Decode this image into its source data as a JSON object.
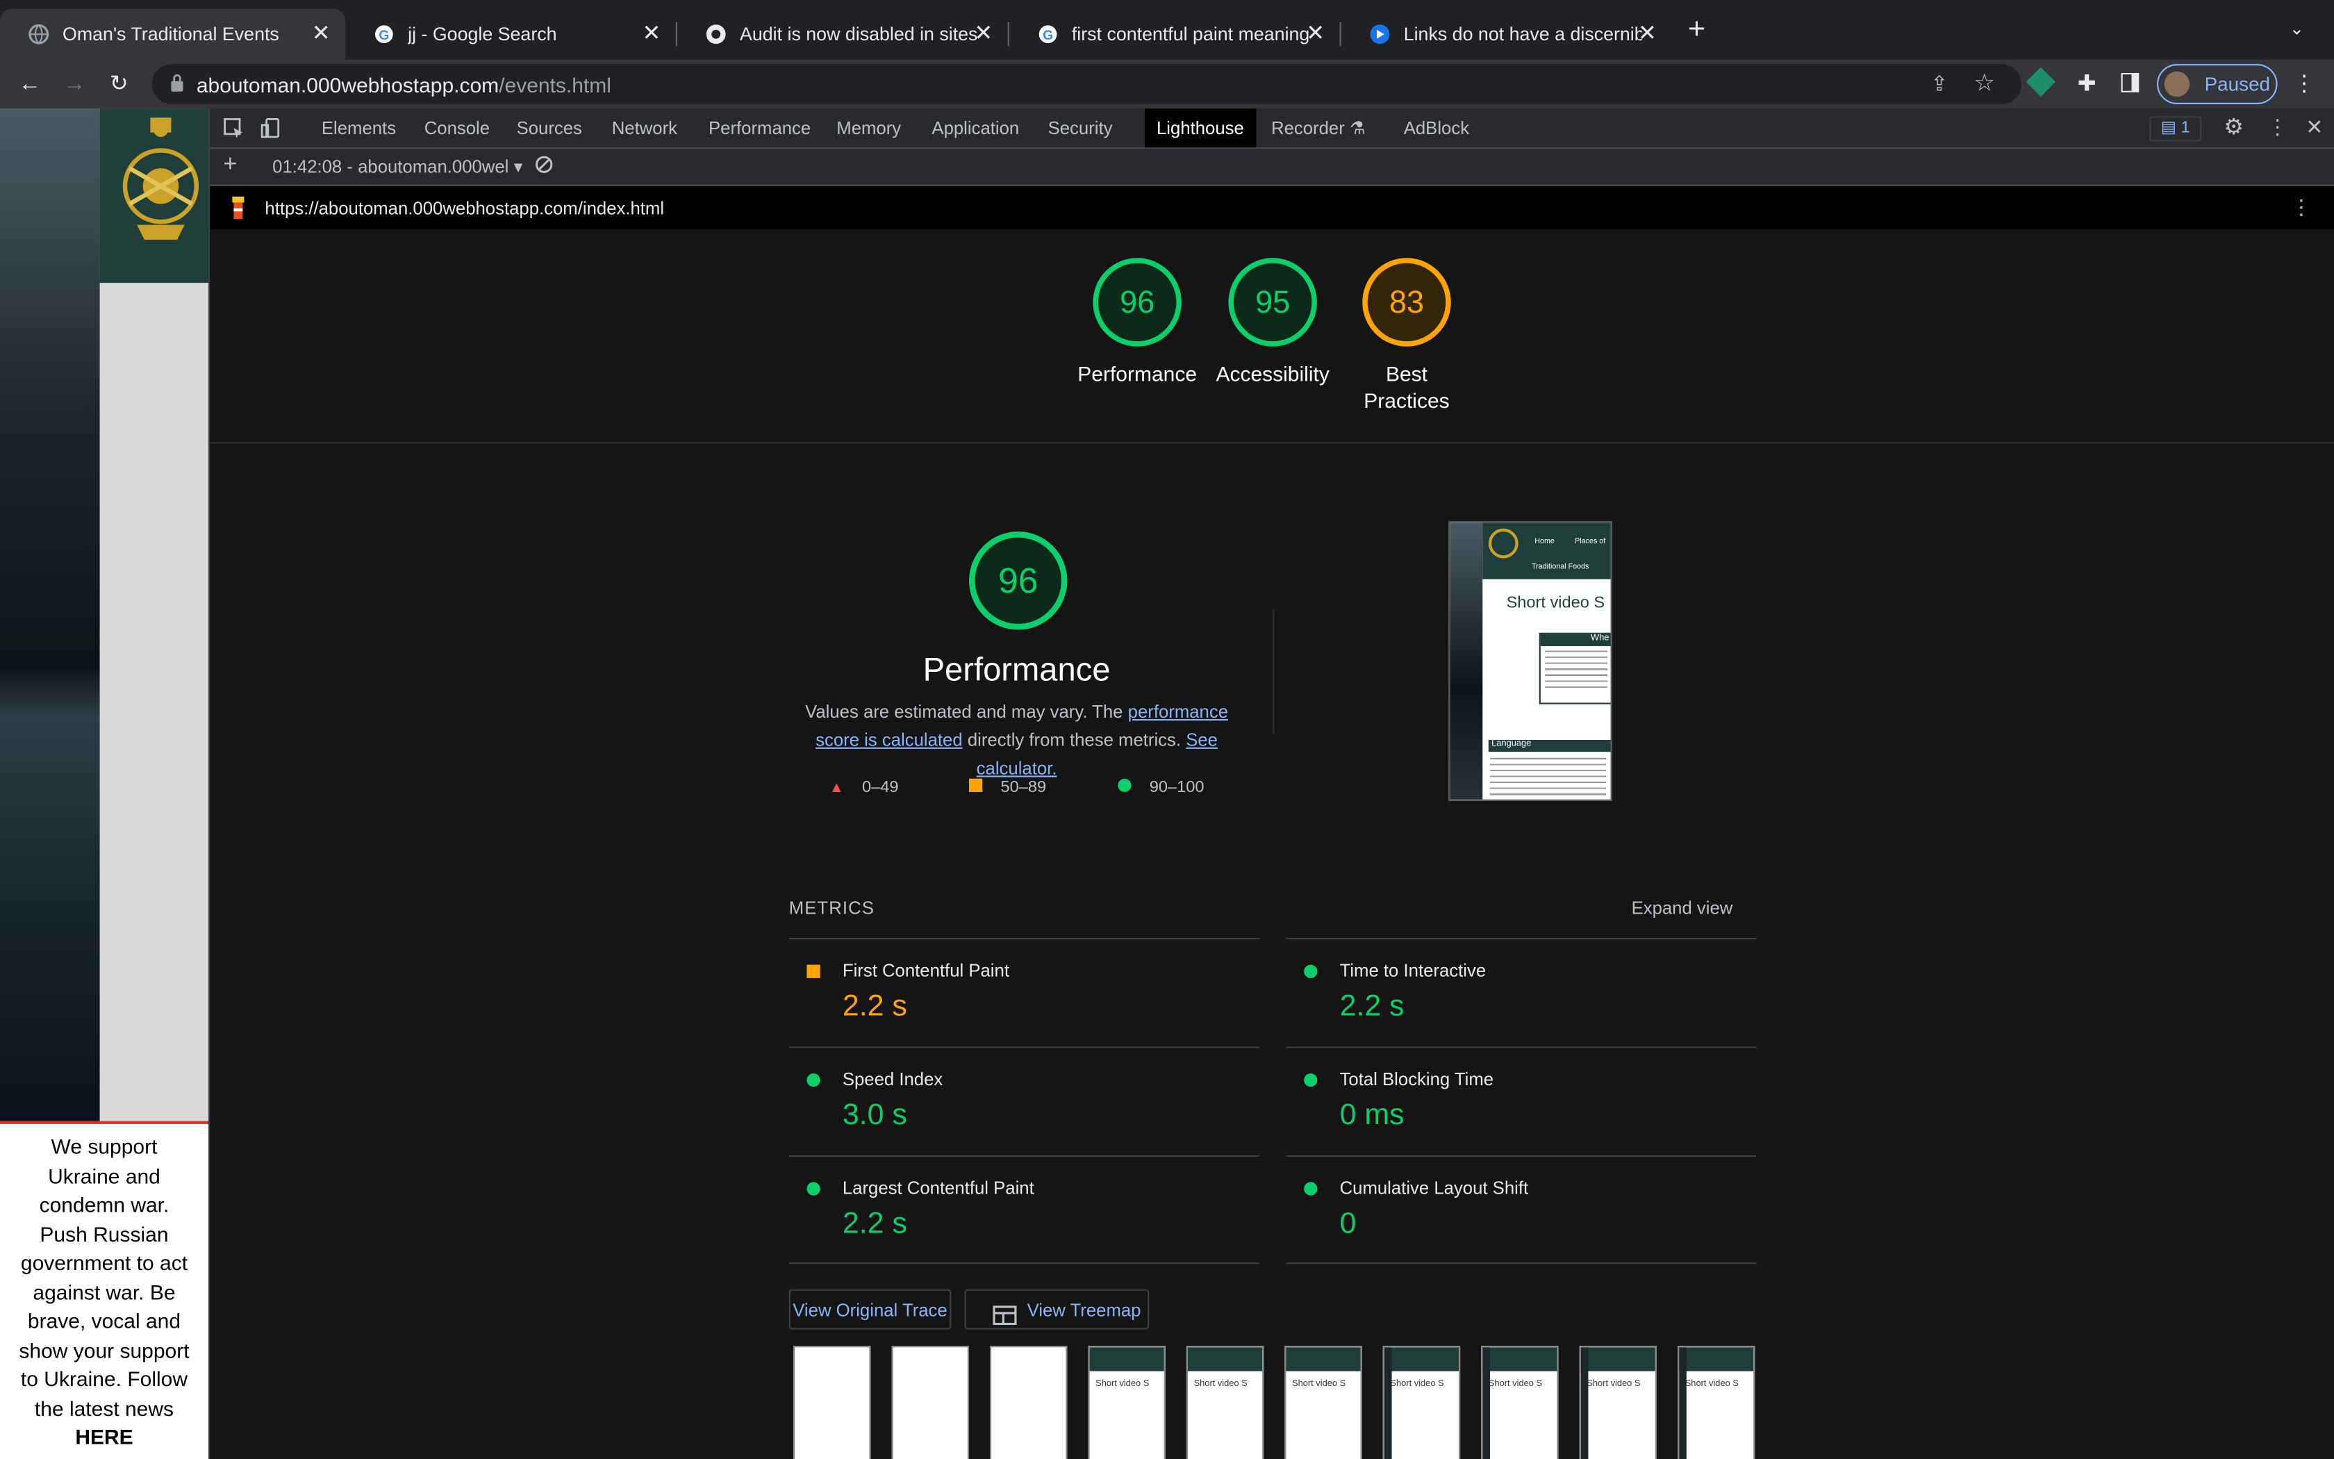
{
  "browser": {
    "tabs": [
      {
        "title": "Oman's Traditional Events",
        "icon": "globe-icon",
        "active": true
      },
      {
        "title": "jj - Google Search",
        "icon": "google-icon"
      },
      {
        "title": "Audit is now disabled in sites n",
        "icon": "github-icon"
      },
      {
        "title": "first contentful paint meaning -",
        "icon": "google-icon"
      },
      {
        "title": "Links do not have a discernible",
        "icon": "lighthouse-icon"
      }
    ],
    "url_host": "aboutoman.000webhostapp.com",
    "url_path": "/events.html",
    "profile_label": "Paused"
  },
  "page": {
    "notice_lines": [
      "We support",
      "Ukraine and",
      "condemn war.",
      "Push Russian",
      "government to act",
      "against war. Be",
      "brave, vocal and",
      "show your support",
      "to Ukraine. Follow",
      "the latest news"
    ],
    "notice_link": "HERE"
  },
  "devtools": {
    "tabs": [
      "Elements",
      "Console",
      "Sources",
      "Network",
      "Performance",
      "Memory",
      "Application",
      "Security",
      "Lighthouse",
      "Recorder",
      "AdBlock"
    ],
    "selected_tab": "Lighthouse",
    "issues_count": "1",
    "report_selector": "01:42:08 - aboutoman.000wel",
    "report_url": "https://aboutoman.000webhostapp.com/index.html"
  },
  "lighthouse": {
    "scores": [
      {
        "label": "Performance",
        "value": 96,
        "status": "pass"
      },
      {
        "label": "Accessibility",
        "value": 95,
        "status": "pass"
      },
      {
        "label": "Best Practices",
        "value": 83,
        "status": "average"
      }
    ],
    "performance": {
      "score": 96,
      "title": "Performance",
      "desc_prefix": "Values are estimated and may vary. The",
      "desc_link1": "performance score is calculated",
      "desc_middle": "directly from these metrics.",
      "desc_link2": "See calculator.",
      "legend": [
        "0–49",
        "50–89",
        "90–100"
      ]
    },
    "metrics_header": "METRICS",
    "expand_label": "Expand view",
    "metrics": [
      {
        "name": "First Contentful Paint",
        "value": "2.2 s",
        "status": "average"
      },
      {
        "name": "Time to Interactive",
        "value": "2.2 s",
        "status": "pass"
      },
      {
        "name": "Speed Index",
        "value": "3.0 s",
        "status": "pass"
      },
      {
        "name": "Total Blocking Time",
        "value": "0 ms",
        "status": "pass"
      },
      {
        "name": "Largest Contentful Paint",
        "value": "2.2 s",
        "status": "pass"
      },
      {
        "name": "Cumulative Layout Shift",
        "value": "0",
        "status": "pass"
      }
    ],
    "buttons": {
      "trace": "View Original Trace",
      "treemap": "View Treemap"
    },
    "screenshot_text": {
      "nav1": "Home",
      "nav2": "Places of",
      "nav3": "Traditional Foods",
      "heading": "Short video S",
      "box_title": "Whe",
      "lang": "Language"
    },
    "thumb_heading": "Short video S"
  },
  "colors": {
    "pass": "#0cce6b",
    "average": "#ffa400",
    "fail": "#ff4e42",
    "accent": "#8ab4f8"
  }
}
